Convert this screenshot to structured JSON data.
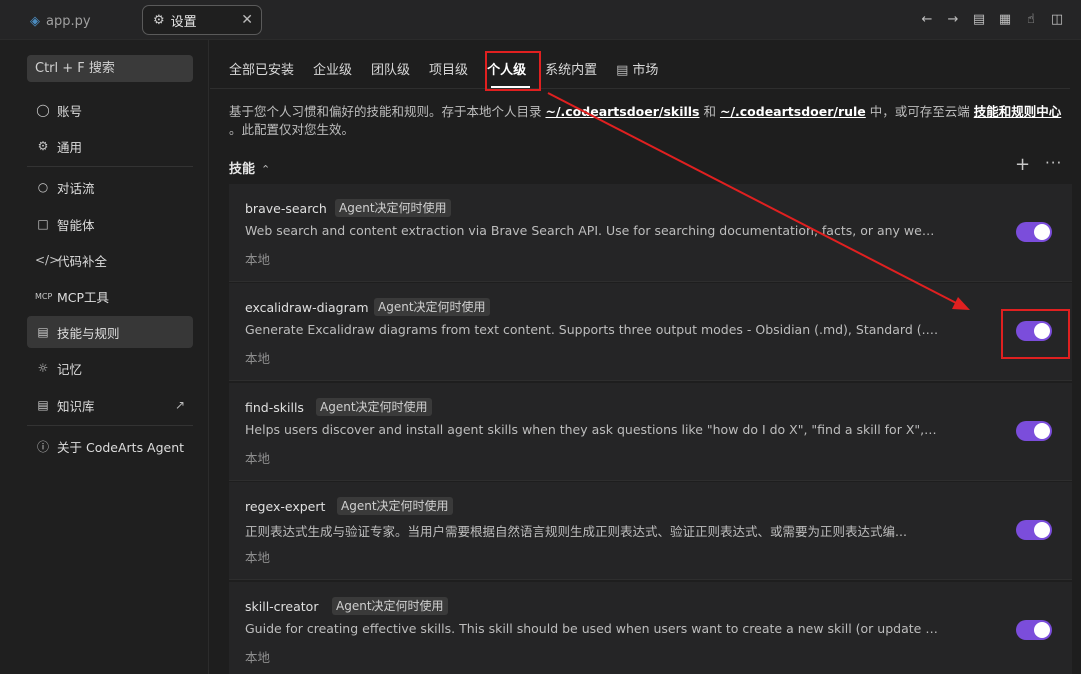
{
  "tabs": [
    {
      "label": "app.py"
    },
    {
      "label": "设置"
    }
  ],
  "sidebar": {
    "search_placeholder": "Ctrl + F 搜索",
    "items": [
      {
        "label": "账号",
        "icon": "person-icon"
      },
      {
        "label": "通用",
        "icon": "gear-icon"
      },
      {
        "label": "对话流",
        "icon": "chat-icon"
      },
      {
        "label": "智能体",
        "icon": "agent-icon"
      },
      {
        "label": "代码补全",
        "icon": "code-icon"
      },
      {
        "label": "MCP工具",
        "icon": "mcp-icon"
      },
      {
        "label": "技能与规则",
        "icon": "list-icon"
      },
      {
        "label": "记忆",
        "icon": "memory-icon"
      },
      {
        "label": "知识库",
        "icon": "book-icon"
      },
      {
        "label": "关于 CodeArts Agent",
        "icon": "info-icon"
      }
    ]
  },
  "main": {
    "subtabs": [
      {
        "label": "全部已安装"
      },
      {
        "label": "企业级"
      },
      {
        "label": "团队级"
      },
      {
        "label": "项目级"
      },
      {
        "label": "个人级"
      },
      {
        "label": "系统内置"
      },
      {
        "label": "市场"
      }
    ],
    "description": {
      "p1": "基于您个人习惯和偏好的技能和规则。存于本地个人目录 ",
      "link1": "~/.codeartsdoer/skills",
      "p2": " 和 ",
      "link2": "~/.codeartsdoer/rule",
      "p3": " 中，或可存至云端 ",
      "link3": "技能和规则中心",
      "p4": " 。此配置仅对您生效。"
    },
    "section_title": "技能",
    "skills": [
      {
        "name": "brave-search",
        "badge": "Agent决定何时使用",
        "desc": "Web search and content extraction via Brave Search API. Use for searching documentation, facts, or any web content. L...",
        "location": "本地",
        "enabled": true
      },
      {
        "name": "excalidraw-diagram",
        "badge": "Agent决定何时使用",
        "desc": "Generate Excalidraw diagrams from text content. Supports three output modes - Obsidian (.md), Standard (.excalidraw)...",
        "location": "本地",
        "enabled": true
      },
      {
        "name": "find-skills",
        "badge": "Agent决定何时使用",
        "desc": "Helps users discover and install agent skills when they ask questions like \"how do I do X\", \"find a skill for X\", \"is there a ...",
        "location": "本地",
        "enabled": true
      },
      {
        "name": "regex-expert",
        "badge": "Agent决定何时使用",
        "desc": "正则表达式生成与验证专家。当用户需要根据自然语言规则生成正则表达式、验证正则表达式、或需要为正则表达式编...",
        "location": "本地",
        "enabled": true
      },
      {
        "name": "skill-creator",
        "badge": "Agent决定何时使用",
        "desc": "Guide for creating effective skills. This skill should be used when users want to create a new skill (or update an existing ...",
        "location": "本地",
        "enabled": true
      }
    ]
  },
  "colors": {
    "accent": "#7b4ddb",
    "annotation": "#e02020"
  }
}
